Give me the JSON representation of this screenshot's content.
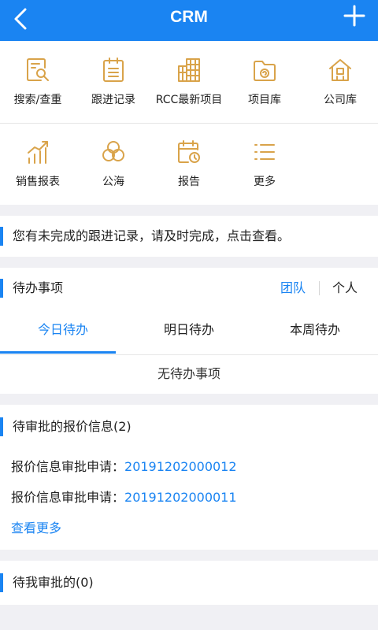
{
  "header": {
    "title": "CRM",
    "back_icon": "chevron-left-icon",
    "add_icon": "plus-icon"
  },
  "grid": {
    "icon_color": "#d9a34a",
    "items": [
      {
        "label": "搜索/查重",
        "icon": "search-document-icon"
      },
      {
        "label": "跟进记录",
        "icon": "clipboard-list-icon"
      },
      {
        "label": "RCC最新项目",
        "icon": "buildings-icon"
      },
      {
        "label": "项目库",
        "icon": "folder-icon"
      },
      {
        "label": "公司库",
        "icon": "company-house-icon"
      },
      {
        "label": "销售报表",
        "icon": "bar-chart-icon"
      },
      {
        "label": "公海",
        "icon": "cloud-icon"
      },
      {
        "label": "报告",
        "icon": "calendar-clock-icon"
      },
      {
        "label": "更多",
        "icon": "list-icon"
      }
    ]
  },
  "notice": {
    "text": "您有未完成的跟进记录，请及时完成，点击查看。"
  },
  "todo": {
    "title": "待办事项",
    "team": "团队",
    "personal": "个人",
    "tabs": [
      {
        "label": "今日待办",
        "active": true
      },
      {
        "label": "明日待办",
        "active": false
      },
      {
        "label": "本周待办",
        "active": false
      }
    ],
    "empty": "无待办事项"
  },
  "quote": {
    "title": "待审批的报价信息(2)",
    "rows": [
      {
        "key": "报价信息审批申请：",
        "value": "20191202000012"
      },
      {
        "key": "报价信息审批申请：",
        "value": "20191202000011"
      }
    ],
    "more": "查看更多"
  },
  "mine": {
    "title": "待我审批的(0)"
  },
  "colors": {
    "accent": "#1a84f2",
    "icon_gold": "#d9a34a"
  }
}
